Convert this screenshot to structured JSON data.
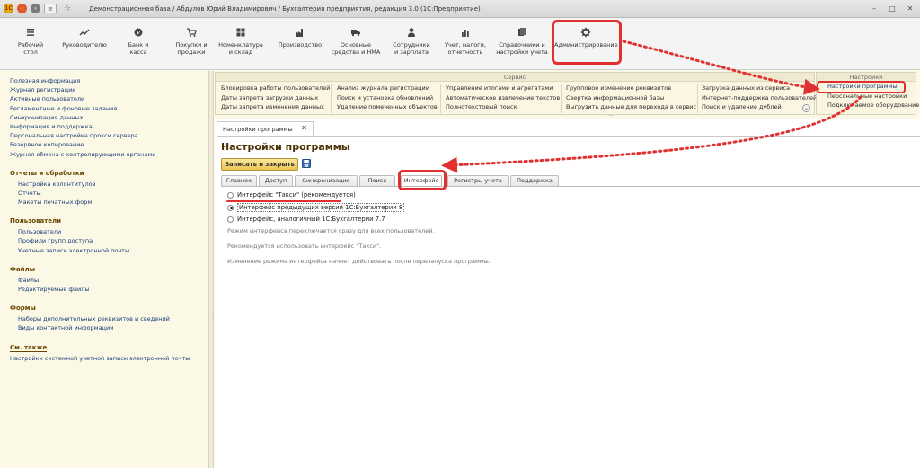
{
  "window": {
    "title": "Демонстрационная база / Абдулов Юрий Владимирович / Бухгалтерия предприятия, редакция 3.0  (1С:Предприятие)",
    "logo_text": "1С"
  },
  "sections": [
    {
      "line1": "Рабочий",
      "line2": "стол",
      "icon": "menu-icon"
    },
    {
      "line1": "Руководителю",
      "line2": "",
      "icon": "chart-line-icon"
    },
    {
      "line1": "Банк и",
      "line2": "касса",
      "icon": "coin-icon"
    },
    {
      "line1": "Покупки и",
      "line2": "продажи",
      "icon": "cart-icon"
    },
    {
      "line1": "Номенклатура",
      "line2": "и склад",
      "icon": "grid-icon"
    },
    {
      "line1": "Производство",
      "line2": "",
      "icon": "factory-icon"
    },
    {
      "line1": "Основные",
      "line2": "средства и НМА",
      "icon": "truck-icon"
    },
    {
      "line1": "Сотрудники",
      "line2": "и зарплата",
      "icon": "person-icon"
    },
    {
      "line1": "Учет, налоги,",
      "line2": "отчетность",
      "icon": "bar-chart-icon"
    },
    {
      "line1": "Справочники и",
      "line2": "настройки учета",
      "icon": "books-icon"
    },
    {
      "line1": "Администрирование",
      "line2": "",
      "icon": "gear-icon"
    }
  ],
  "leftnav": {
    "top_items": [
      "Полезная информация",
      "Журнал регистрации",
      "Активные пользователи",
      "Регламентные и фоновые задания",
      "Синхронизация данных",
      "Информация и поддержка",
      "Персональная настройка прокси сервера",
      "Резервное копирование",
      "Журнал обмена с контролирующими органами"
    ],
    "groups": [
      {
        "title": "Отчеты и обработки",
        "items": [
          "Настройка колонтитулов",
          "Отчеты",
          "Макеты печатных форм"
        ]
      },
      {
        "title": "Пользователи",
        "items": [
          "Пользователи",
          "Профили групп доступа",
          "Учетные записи электронной почты"
        ]
      },
      {
        "title": "Файлы",
        "items": [
          "Файлы",
          "Редактируемые файлы"
        ]
      },
      {
        "title": "Формы",
        "items": [
          "Наборы дополнительных реквизитов и сведений",
          "Виды контактной информации"
        ]
      }
    ],
    "see_also": {
      "title": "См. также",
      "items": [
        "Настройки системной учетной записи электронной почты"
      ]
    }
  },
  "service": {
    "title": "Сервис",
    "columns": [
      [
        "Блокировка работы пользователей",
        "Даты запрета загрузки данных",
        "Даты запрета изменения данных"
      ],
      [
        "Анализ журнала регистрации",
        "Поиск и установка обновлений",
        "Удаление помеченных объектов"
      ],
      [
        "Управление итогами и агрегатами",
        "Автоматическое извлечение текстов",
        "Полнотекстовый поиск"
      ],
      [
        "Групповое изменение реквизитов",
        "Свертка информационной базы",
        "Выгрузить данные для перехода в сервис"
      ],
      [
        "Загрузка данных из сервиса",
        "Интернет-поддержка пользователей",
        "Поиск и удаление дублей"
      ]
    ]
  },
  "settings_panel": {
    "title": "Настройки",
    "items": [
      "Настройки программы",
      "Персональные настройки",
      "Подключаемое оборудование"
    ]
  },
  "form": {
    "tab_title": "Настройки программы",
    "title": "Настройки программы",
    "save_close_label": "Записать и закрыть",
    "tabs": [
      "Главное",
      "Доступ",
      "Синхронизация",
      "Поиск",
      "Интерфейс",
      "Регистры учета",
      "Поддержка"
    ],
    "active_tab": "Интерфейс",
    "radios": [
      {
        "label": "Интерфейс \"Такси\" (рекомендуется)",
        "checked": false
      },
      {
        "label": "Интерфейс предыдущих версий 1С:Бухгалтерии 8",
        "checked": true
      },
      {
        "label": "Интерфейс, аналогичный 1С:Бухгалтерии 7.7",
        "checked": false
      }
    ],
    "info": [
      "Режим интерфейса переключается сразу для всех пользователей.",
      "Рекомендуется использовать интерфейс \"Такси\".",
      "Изменение режима интерфейса начнет действовать после перезапуска программы."
    ]
  },
  "colors": {
    "highlight": "#e03030",
    "link": "#1a3e7a",
    "group_title": "#6b4500",
    "background": "#fbf8e5"
  }
}
